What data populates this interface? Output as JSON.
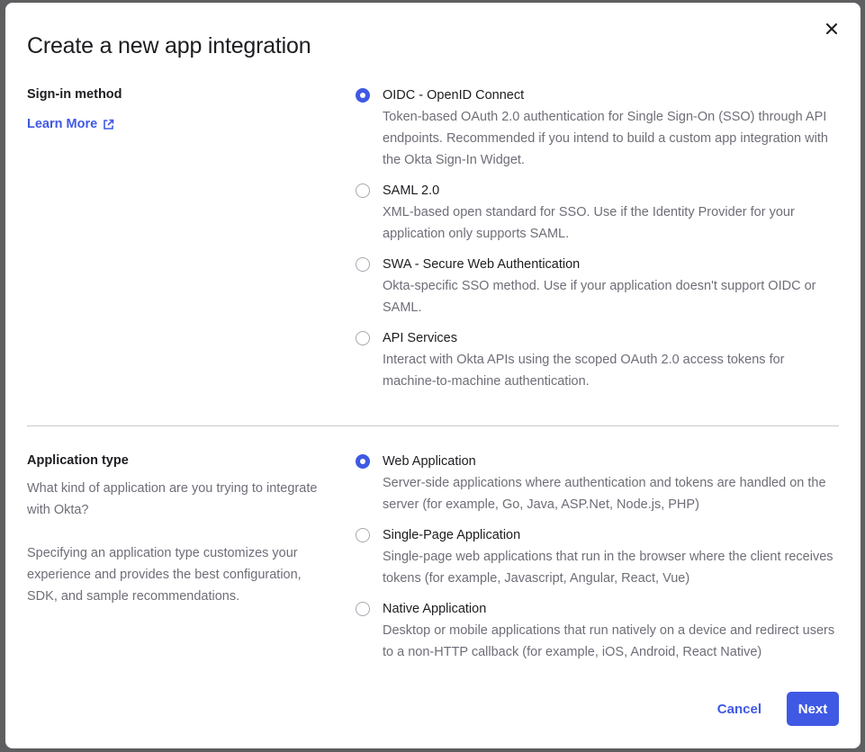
{
  "dialog": {
    "title": "Create a new app integration"
  },
  "sign_in": {
    "heading": "Sign-in method",
    "learn_more": "Learn More",
    "selected": "OIDC - OpenID Connect",
    "options": [
      {
        "label": "OIDC - OpenID Connect",
        "description": "Token-based OAuth 2.0 authentication for Single Sign-On (SSO) through API endpoints. Recommended if you intend to build a custom app integration with the Okta Sign-In Widget.",
        "checked": true
      },
      {
        "label": "SAML 2.0",
        "description": "XML-based open standard for SSO. Use if the Identity Provider for your application only supports SAML.",
        "checked": false
      },
      {
        "label": "SWA - Secure Web Authentication",
        "description": "Okta-specific SSO method. Use if your application doesn't support OIDC or SAML.",
        "checked": false
      },
      {
        "label": "API Services",
        "description": "Interact with Okta APIs using the scoped OAuth 2.0 access tokens for machine-to-machine authentication.",
        "checked": false
      }
    ]
  },
  "app_type": {
    "heading": "Application type",
    "question": "What kind of application are you trying to integrate with Okta?",
    "explanation": "Specifying an application type customizes your experience and provides the best configuration, SDK, and sample recommendations.",
    "selected": "Web Application",
    "options": [
      {
        "label": "Web Application",
        "description": "Server-side applications where authentication and tokens are handled on the server (for example, Go, Java, ASP.Net, Node.js, PHP)",
        "checked": true
      },
      {
        "label": "Single-Page Application",
        "description": "Single-page web applications that run in the browser where the client receives tokens (for example, Javascript, Angular, React, Vue)",
        "checked": false
      },
      {
        "label": "Native Application",
        "description": "Desktop or mobile applications that run natively on a device and redirect users to a non-HTTP callback (for example, iOS, Android, React Native)",
        "checked": false
      }
    ]
  },
  "footer": {
    "cancel_label": "Cancel",
    "next_label": "Next"
  },
  "colors": {
    "accent": "#3f59e4",
    "text_primary": "#1d1d21",
    "text_secondary": "#6e6e78",
    "overlay": "#5f5f61"
  },
  "icons": {
    "close": "close-icon",
    "external_link": "external-link-icon"
  }
}
